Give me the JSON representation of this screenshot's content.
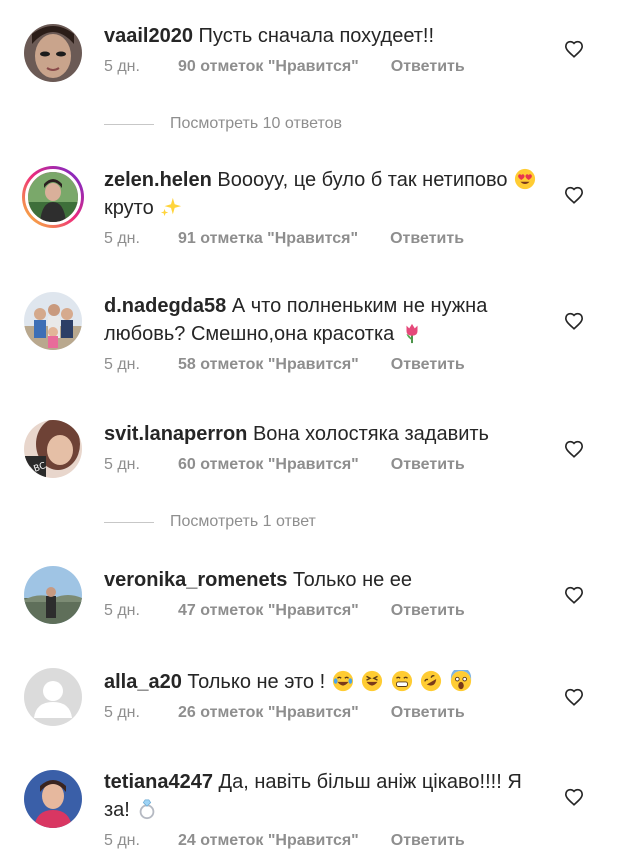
{
  "comments": [
    {
      "username": "vaail2020",
      "text": "Пусть сначала похудеет!!",
      "time": "5 дн.",
      "likes": "90 отметок \"Нравится\"",
      "reply": "Ответить",
      "avatar": "avatar-photo",
      "view_replies": "Посмотреть 10 ответов"
    },
    {
      "username": "zelen.helen",
      "text_part1": "Boooyy, це було б так нетипово",
      "text_part2": "круто",
      "time": "5 дн.",
      "likes": "91 отметка \"Нравится\"",
      "reply": "Ответить",
      "avatar": "avatar-story-photo",
      "emojis": [
        "heart-eyes-emoji",
        "sparkles-emoji"
      ]
    },
    {
      "username": "d.nadegda58",
      "text": "А что полненьким не нужна любовь? Смешно,она красотка",
      "time": "5 дн.",
      "likes": "58 отметок \"Нравится\"",
      "reply": "Ответить",
      "avatar": "avatar-family-photo",
      "emojis": [
        "tulip-emoji"
      ]
    },
    {
      "username": "svit.lanaperron",
      "text": "Вона холостяка задавить",
      "time": "5 дн.",
      "likes": "60 отметок \"Нравится\"",
      "reply": "Ответить",
      "avatar": "avatar-photo",
      "view_replies": "Посмотреть 1 ответ"
    },
    {
      "username": "veronika_romenets",
      "text": "Только не ее",
      "time": "5 дн.",
      "likes": "47 отметок \"Нравится\"",
      "reply": "Ответить",
      "avatar": "avatar-landscape-photo"
    },
    {
      "username": "alla_a20",
      "text": "Только не это !",
      "time": "5 дн.",
      "likes": "26 отметок \"Нравится\"",
      "reply": "Ответить",
      "avatar": "default-avatar",
      "emojis": [
        "joy-emoji",
        "laughing-emoji",
        "grin-emoji",
        "rofl-emoji",
        "scream-emoji"
      ]
    },
    {
      "username": "tetiana4247",
      "text": "Да, навіть більш аніж цікаво!!!! Я за!",
      "time": "5 дн.",
      "likes": "24 отметок \"Нравится\"",
      "reply": "Ответить",
      "avatar": "avatar-photo",
      "emojis": [
        "ring-emoji"
      ]
    }
  ],
  "colors": {
    "text": "#262626",
    "secondary": "#8e8e8e",
    "divider": "#c7c7c7"
  },
  "icons": {
    "like": "heart-outline-icon"
  }
}
